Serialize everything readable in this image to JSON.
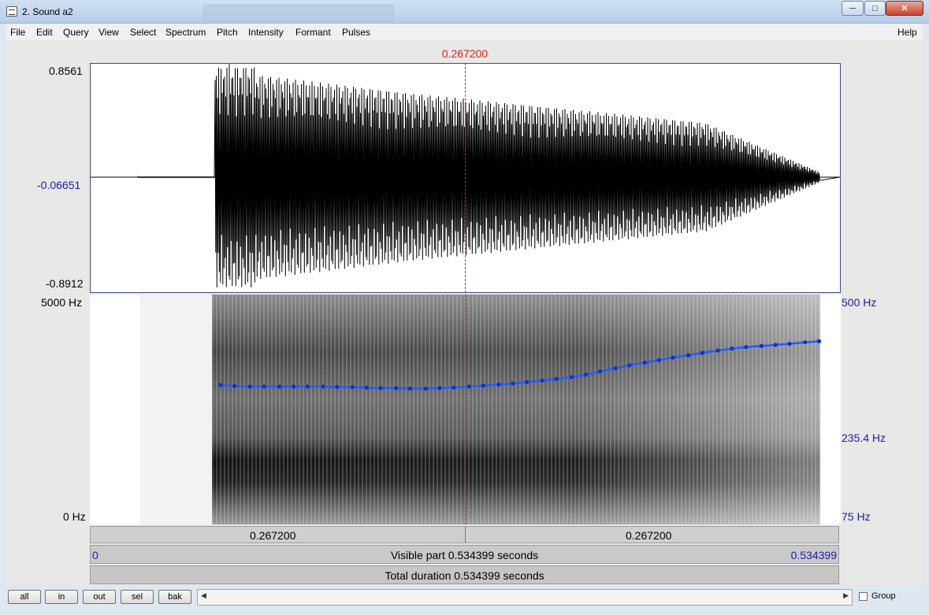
{
  "window": {
    "title": "2. Sound a2",
    "min_glyph": "─",
    "max_glyph": "□",
    "close_glyph": "✕"
  },
  "menu": {
    "file": "File",
    "edit": "Edit",
    "query": "Query",
    "view": "View",
    "select": "Select",
    "spectrum": "Spectrum",
    "pitch": "Pitch",
    "intensity": "Intensity",
    "formant": "Formant",
    "pulses": "Pulses",
    "help": "Help"
  },
  "cursor_time": "0.267200",
  "waveform": {
    "ymax": "0.8561",
    "ymid": "-0.06651",
    "ymin": "-0.8912"
  },
  "spectrogram": {
    "freq_top": "5000 Hz",
    "freq_bottom": "0 Hz",
    "pitch_top": "500 Hz",
    "pitch_mid": "235.4 Hz",
    "pitch_bottom": "75 Hz",
    "pitch_color": "#1f5dff"
  },
  "pitch_contour": {
    "time_range": [
      0,
      0.534399
    ],
    "pitch_range_hz": [
      75,
      500
    ],
    "times": [
      0.093,
      0.103,
      0.114,
      0.124,
      0.135,
      0.145,
      0.155,
      0.166,
      0.176,
      0.187,
      0.197,
      0.207,
      0.218,
      0.228,
      0.239,
      0.249,
      0.259,
      0.27,
      0.28,
      0.291,
      0.301,
      0.311,
      0.322,
      0.332,
      0.343,
      0.353,
      0.363,
      0.374,
      0.384,
      0.395,
      0.405,
      0.415,
      0.426,
      0.436,
      0.447,
      0.457,
      0.467,
      0.478,
      0.488,
      0.498,
      0.509,
      0.519
    ],
    "values_hz": [
      237,
      235,
      234,
      234,
      234,
      234,
      234,
      234,
      233,
      233,
      232,
      231,
      231,
      230,
      230,
      231,
      232,
      234,
      236,
      238,
      240,
      243,
      246,
      249,
      253,
      258,
      265,
      272,
      279,
      285,
      291,
      297,
      303,
      309,
      315,
      320,
      324,
      327,
      330,
      333,
      337,
      340
    ]
  },
  "time_bar": {
    "left": "0.267200",
    "right": "0.267200"
  },
  "visible_bar": {
    "start": "0",
    "label": "Visible part 0.534399 seconds",
    "end": "0.534399"
  },
  "total_bar": {
    "label": "Total duration 0.534399 seconds"
  },
  "buttons": {
    "all": "all",
    "in": "in",
    "out": "out",
    "sel": "sel",
    "bak": "bak"
  },
  "group": {
    "label": "Group"
  }
}
